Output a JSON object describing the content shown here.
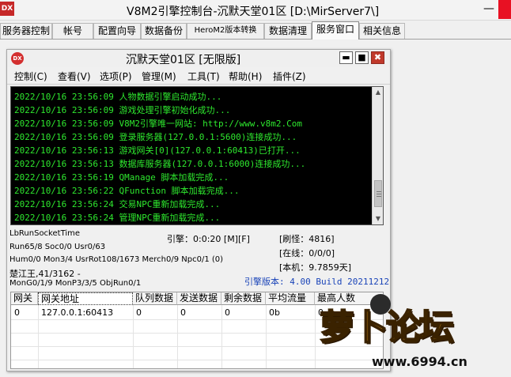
{
  "outer": {
    "title": "V8M2引擎控制台-沉默天堂01区 [D:\\MirServer7\\]",
    "minimize_glyph": "—",
    "tabs": [
      {
        "label": "服务器控制"
      },
      {
        "label": "帐号"
      },
      {
        "label": "配置向导"
      },
      {
        "label": "数据备份"
      },
      {
        "label": "HeroM2版本转换"
      },
      {
        "label": "数据清理"
      },
      {
        "label": "服务窗口",
        "active": true
      },
      {
        "label": "相关信息"
      }
    ]
  },
  "inner": {
    "title": "沉默天堂01区 [无限版]",
    "logo_text": "DX",
    "buttons": {
      "minimize": "▬",
      "maximize": "■",
      "close": "✖"
    },
    "menu": [
      "控制(C)",
      "查看(V)",
      "选项(P)",
      "管理(M)",
      "工具(T)",
      "帮助(H)",
      "插件(Z)"
    ],
    "log": [
      "2022/10/16 23:56:09 人物数据引擎启动成功...",
      "2022/10/16 23:56:09 游戏处理引擎初始化成功...",
      "2022/10/16 23:56:09 V8M2引擎唯一网站: http://www.v8m2.Com",
      "2022/10/16 23:56:09 登录服务器(127.0.0.1:5600)连接成功...",
      "2022/10/16 23:56:13 游戏网关[0](127.0.0.1:60413)已打开...",
      "2022/10/16 23:56:13 数据库服务器(127.0.0.1:6000)连接成功...",
      "2022/10/16 23:56:19 QManage 脚本加载完成...",
      "2022/10/16 23:56:22 QFunction 脚本加载完成...",
      "2022/10/16 23:56:24 交易NPC重新加载完成...",
      "2022/10/16 23:56:24 管理NPC重新加载完成..."
    ],
    "status": {
      "socket_time": "LbRunSocketTime",
      "engine_time": "引擎：0:0:20 [M][F]",
      "refresh_monster": "[刷怪：4816]",
      "run_line": "Run65/8 Soc0/0 Usr0/63",
      "online": "[在线：0/0/0]",
      "hum_line": "Hum0/0 Mon3/4 UsrRot108/1673 Merch0/9 Npc0/1 (0)",
      "local": "[本机：9.7859天]",
      "king": "楚江王,41/3162 -",
      "mon_line": "MonG0/1/9 MonP3/3/5 ObjRun0/1",
      "engine_version": "引擎版本: 4.00 Build 20211212"
    },
    "gateway_table": {
      "columns": [
        "网关",
        "网关地址",
        "队列数据",
        "发送数据",
        "剩余数据",
        "平均流量",
        "最高人数"
      ],
      "rows": [
        [
          "0",
          "127.0.0.1:60413",
          "0",
          "0",
          "0",
          "0b",
          "0"
        ]
      ]
    }
  },
  "watermark": {
    "logo_text": "萝卜论坛",
    "url": "www.6994.cn"
  },
  "colors": {
    "console_bg": "#000000",
    "console_text": "#2ee82e",
    "engine_version": "#1a44b8",
    "close_button": "#e81123"
  }
}
